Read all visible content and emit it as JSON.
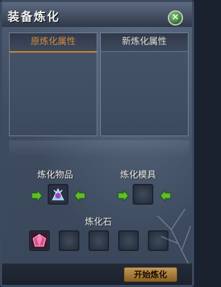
{
  "window": {
    "title": "装备炼化"
  },
  "attributes": {
    "original_label": "原炼化属性",
    "new_label": "新炼化属性"
  },
  "refine": {
    "item_label": "炼化物品",
    "mold_label": "炼化模具",
    "stone_label": "炼化石"
  },
  "buttons": {
    "start_label": "开始炼化",
    "close_glyph": "✕"
  },
  "icons": {
    "close": "close-icon",
    "arrow": "green-arrow-icon",
    "item": "equipment-icon",
    "stone": "gem-icon"
  },
  "colors": {
    "accent": "#d4882e",
    "arrow_green": "#5bbf2a"
  }
}
